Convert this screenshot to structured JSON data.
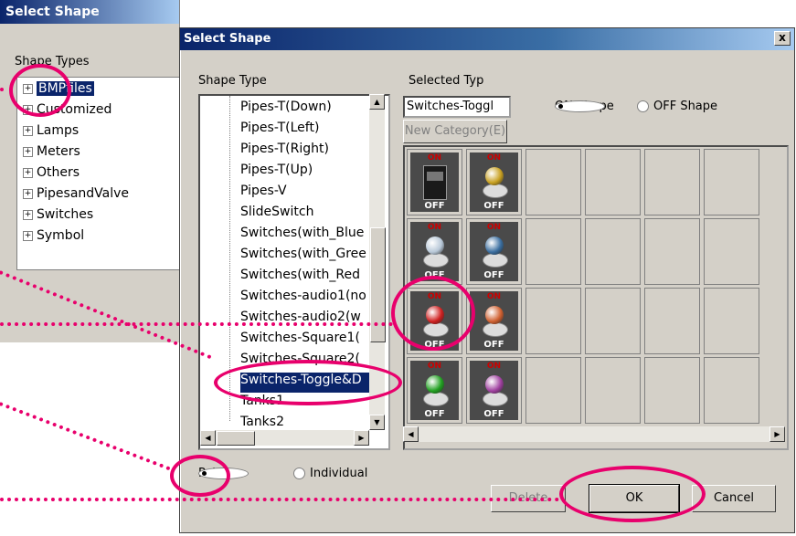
{
  "bg_dialog": {
    "title": "Select Shape",
    "types_label": "Shape Types",
    "tree": [
      "BMPfiles",
      "Customized",
      "Lamps",
      "Meters",
      "Others",
      "PipesandValve",
      "Switches",
      "Symbol"
    ]
  },
  "dialog": {
    "title": "Select Shape",
    "close_label": "x",
    "shape_type_label": "Shape Type",
    "selected_type_label": "Selected Typ",
    "selected_type_value": "Switches-Toggl",
    "new_category_label": "New Category(E)",
    "on_shape_label": "ON Shape",
    "off_shape_label": "OFF Shape",
    "tree_items": [
      "Pipes-T(Down)",
      "Pipes-T(Left)",
      "Pipes-T(Right)",
      "Pipes-T(Up)",
      "Pipes-V",
      "SlideSwitch",
      "Switches(with_Blue",
      "Switches(with_Gree",
      "Switches(with_Red",
      "Switches-audio1(no",
      "Switches-audio2(w",
      "Switches-Square1(",
      "Switches-Square2(",
      "Switches-Toggle&D",
      "Tanks1",
      "Tanks2"
    ],
    "tree_selected_index": 13,
    "pair_label": "Pair",
    "individual_label": "Individual",
    "delete_label": "Delete",
    "ok_label": "OK",
    "cancel_label": "Cancel",
    "icon_on_text": "ON",
    "icon_off_text": "OFF",
    "shape_colors": [
      "#1a1a1a",
      "#c8a020",
      "#b8c8d8",
      "#3a6ea0",
      "#d02020",
      "#d06030",
      "#20a020",
      "#a040a0"
    ]
  }
}
